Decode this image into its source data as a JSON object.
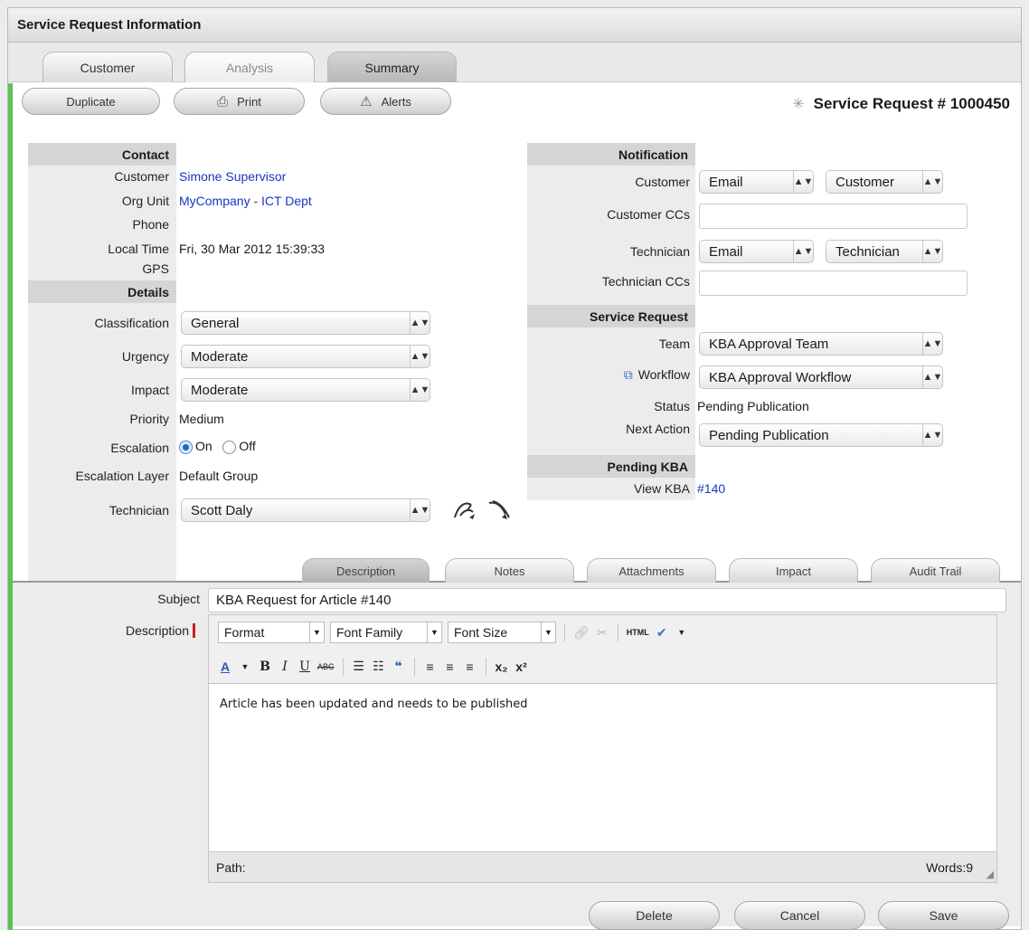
{
  "window": {
    "title": "Service Request Information"
  },
  "main_tabs": [
    {
      "label": "Customer"
    },
    {
      "label": "Analysis"
    },
    {
      "label": "Summary"
    }
  ],
  "toolbar": {
    "duplicate_label": "Duplicate",
    "print_label": "Print",
    "alerts_label": "Alerts",
    "service_request_number": "Service Request # 1000450"
  },
  "contact": {
    "section_title": "Contact",
    "customer_label": "Customer",
    "customer_value": "Simone Supervisor",
    "org_unit_label": "Org Unit",
    "org_unit_value": "MyCompany - ICT Dept",
    "phone_label": "Phone",
    "local_time_label": "Local Time",
    "local_time_value": "Fri, 30 Mar 2012 15:39:33",
    "gps_label": "GPS"
  },
  "details": {
    "section_title": "Details",
    "classification_label": "Classification",
    "classification_value": "General",
    "urgency_label": "Urgency",
    "urgency_value": "Moderate",
    "impact_label": "Impact",
    "impact_value": "Moderate",
    "priority_label": "Priority",
    "priority_value": "Medium",
    "escalation_label": "Escalation",
    "escalation_on_label": "On",
    "escalation_off_label": "Off",
    "escalation_selected": "On",
    "escalation_layer_label": "Escalation Layer",
    "escalation_layer_value": "Default Group",
    "technician_label": "Technician",
    "technician_value": "Scott Daly"
  },
  "notification": {
    "section_title": "Notification",
    "customer_label": "Customer",
    "customer_method": "Email",
    "customer_recipient": "Customer",
    "customer_ccs_label": "Customer CCs",
    "customer_ccs_value": "",
    "technician_label": "Technician",
    "technician_method": "Email",
    "technician_recipient": "Technician",
    "technician_ccs_label": "Technician CCs",
    "technician_ccs_value": ""
  },
  "service_request": {
    "section_title": "Service Request",
    "team_label": "Team",
    "team_value": "KBA Approval Team",
    "workflow_label": "Workflow",
    "workflow_value": "KBA Approval Workflow",
    "status_label": "Status",
    "status_value": "Pending Publication",
    "next_action_label": "Next Action",
    "next_action_value": "Pending Publication"
  },
  "pending_kba": {
    "section_title": "Pending KBA",
    "view_kba_label": "View KBA",
    "view_kba_value": "#140"
  },
  "sub_tabs": [
    {
      "label": "Description"
    },
    {
      "label": "Notes"
    },
    {
      "label": "Attachments"
    },
    {
      "label": "Impact"
    },
    {
      "label": "Audit Trail"
    }
  ],
  "description_form": {
    "subject_label": "Subject",
    "subject_value": "KBA Request for Article #140",
    "description_label": "Description",
    "editor": {
      "format_label": "Format",
      "font_family_label": "Font Family",
      "font_size_label": "Font Size",
      "html_label": "HTML",
      "body_text": "Article has been updated and needs to be published",
      "path_label": "Path:",
      "words_label": "Words:9"
    }
  },
  "actions": {
    "delete_label": "Delete",
    "cancel_label": "Cancel",
    "save_label": "Save"
  },
  "colors": {
    "accent_green": "#5cc255",
    "link_blue": "#1a35c2",
    "required_marker": "#cc2222"
  }
}
